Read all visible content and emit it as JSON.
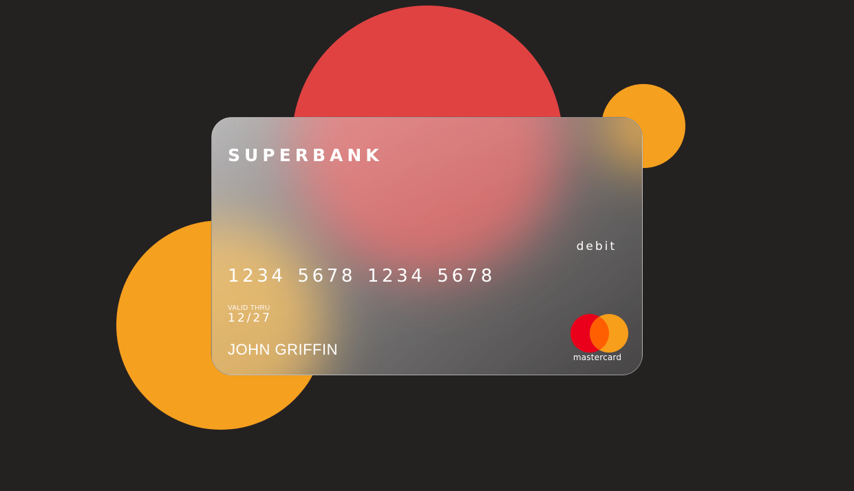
{
  "card": {
    "bank_name": "SUPERBANK",
    "type": "debit",
    "number": "1234 5678 1234 5678",
    "valid_thru_label": "VALID THRU",
    "valid_thru": "12/27",
    "holder_name": "JOHN GRIFFIN",
    "network": "mastercard"
  },
  "colors": {
    "background": "#242121",
    "red": "#e04242",
    "orange": "#f6a01f",
    "mastercard_red": "#eb001b",
    "mastercard_orange": "#f79e1b",
    "mastercard_overlap": "#ff5f00"
  },
  "icons": {
    "network_logo": "mastercard-logo"
  }
}
